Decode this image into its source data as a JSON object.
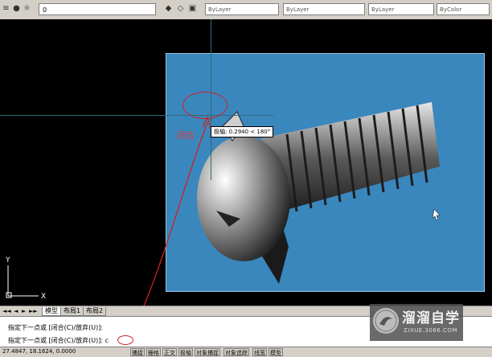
{
  "toolbar": {
    "layer_value": "0",
    "color_value": "ByLayer",
    "linetype_value": "ByLayer",
    "lineweight_value": "ByLayer",
    "plotstyle_value": "ByColor"
  },
  "canvas": {
    "tooltip_label": "极轴:",
    "tooltip_value": "0.2940 < 180°",
    "annotation_label": "闭合"
  },
  "ucs": {
    "y_label": "Y",
    "x_label": "X"
  },
  "tabs": {
    "nav": [
      "◄◄",
      "◄",
      "►",
      "►►"
    ],
    "items": [
      {
        "label": "模型",
        "active": true
      },
      {
        "label": "布局1",
        "active": false
      },
      {
        "label": "布局2",
        "active": false
      }
    ]
  },
  "command": {
    "line1": "指定下一点或 [闭合(C)/放弃(U)]:",
    "line2": "指定下一点或 [闭合(C)/放弃(U)]:",
    "input": "c"
  },
  "status": {
    "coords": "27.4847, 18.1624, 0.0000",
    "buttons": [
      "捕捉",
      "栅格",
      "正交",
      "极轴",
      "对象捕捉",
      "对象追踪",
      "线宽",
      "模型"
    ]
  },
  "watermark": {
    "title": "溜溜自学",
    "url": "ZIXUE.3066.COM"
  },
  "colors": {
    "viewport_bg": "#3a87bd",
    "annotation": "#d02020",
    "canvas_bg": "#000000"
  }
}
